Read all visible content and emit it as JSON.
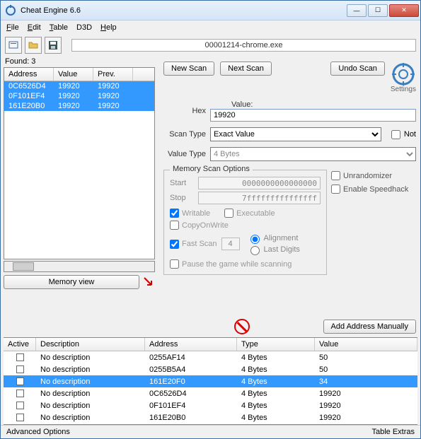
{
  "window": {
    "title": "Cheat Engine 6.6"
  },
  "menu": {
    "file": "File",
    "edit": "Edit",
    "table": "Table",
    "d3d": "D3D",
    "help": "Help"
  },
  "process": "00001214-chrome.exe",
  "found_label": "Found: 3",
  "result_headers": {
    "address": "Address",
    "value": "Value",
    "prev": "Prev."
  },
  "results": [
    {
      "address": "0C6526D4",
      "value": "19920",
      "prev": "19920"
    },
    {
      "address": "0F101EF4",
      "value": "19920",
      "prev": "19920"
    },
    {
      "address": "161E20B0",
      "value": "19920",
      "prev": "19920"
    }
  ],
  "buttons": {
    "memory_view": "Memory view",
    "new_scan": "New Scan",
    "next_scan": "Next Scan",
    "undo_scan": "Undo Scan",
    "add_manually": "Add Address Manually"
  },
  "settings_label": "Settings",
  "value_section": {
    "value_lbl": "Value:",
    "hex_lbl": "Hex",
    "value": "19920",
    "scan_type_lbl": "Scan Type",
    "scan_type": "Exact Value",
    "not_lbl": "Not",
    "value_type_lbl": "Value Type",
    "value_type": "4 Bytes"
  },
  "mem_options": {
    "legend": "Memory Scan Options",
    "start_lbl": "Start",
    "start": "0000000000000000",
    "stop_lbl": "Stop",
    "stop": "7fffffffffffffff",
    "writable": "Writable",
    "executable": "Executable",
    "copyonwrite": "CopyOnWrite",
    "fast_scan": "Fast Scan",
    "fast_val": "4",
    "alignment": "Alignment",
    "last_digits": "Last Digits",
    "pause": "Pause the game while scanning"
  },
  "side": {
    "unrandomizer": "Unrandomizer",
    "speedhack": "Enable Speedhack"
  },
  "addr_headers": {
    "active": "Active",
    "desc": "Description",
    "address": "Address",
    "type": "Type",
    "value": "Value"
  },
  "addr_rows": [
    {
      "desc": "No description",
      "address": "0255AF14",
      "type": "4 Bytes",
      "value": "50",
      "sel": false
    },
    {
      "desc": "No description",
      "address": "0255B5A4",
      "type": "4 Bytes",
      "value": "50",
      "sel": false
    },
    {
      "desc": "No description",
      "address": "161E20F0",
      "type": "4 Bytes",
      "value": "34",
      "sel": true
    },
    {
      "desc": "No description",
      "address": "0C6526D4",
      "type": "4 Bytes",
      "value": "19920",
      "sel": false
    },
    {
      "desc": "No description",
      "address": "0F101EF4",
      "type": "4 Bytes",
      "value": "19920",
      "sel": false
    },
    {
      "desc": "No description",
      "address": "161E20B0",
      "type": "4 Bytes",
      "value": "19920",
      "sel": false
    }
  ],
  "bottom": {
    "advanced": "Advanced Options",
    "extras": "Table Extras"
  }
}
